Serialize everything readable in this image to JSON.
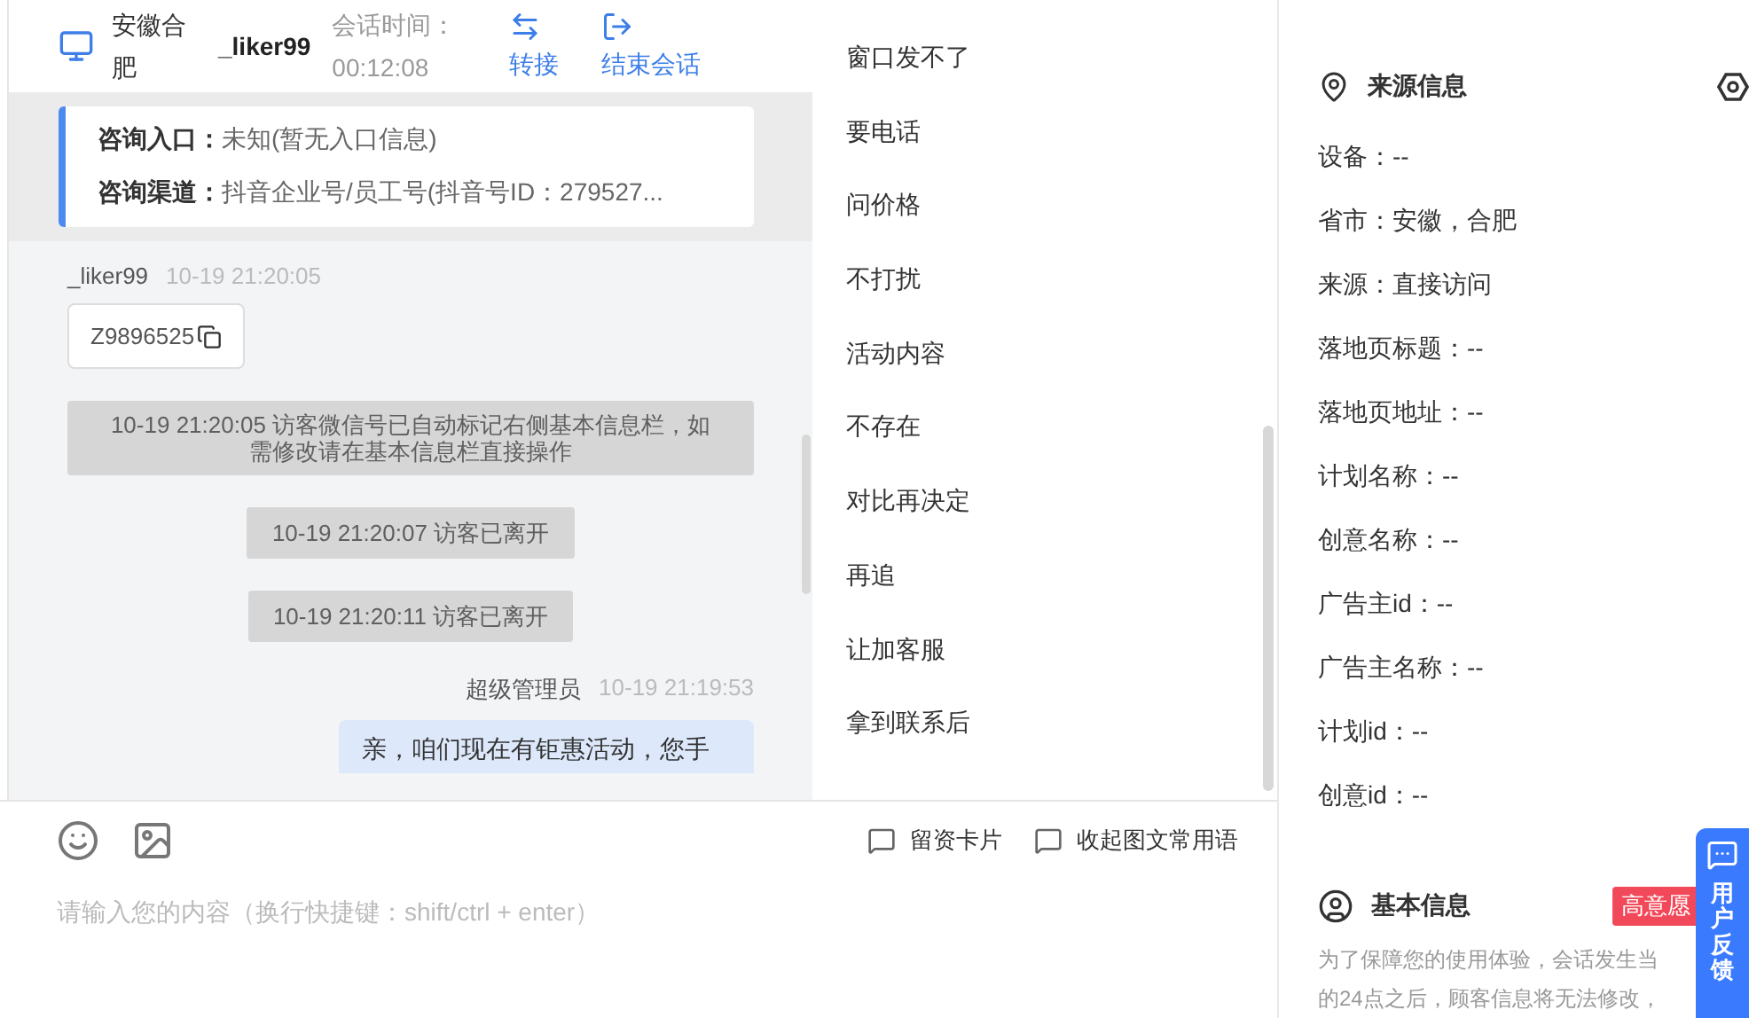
{
  "chat_header": {
    "location": "安徽合肥",
    "visitor": "_liker99",
    "session_time_label": "会话时间：",
    "session_time": "00:12:08",
    "actions": [
      {
        "kind": "transfer",
        "label": "转接"
      },
      {
        "kind": "end",
        "label": "结束会话"
      }
    ]
  },
  "consult_info": [
    "**咨询入口：**未知(暂无入口信息)",
    "**咨询渠道：**抖音企业号/员工号(抖音号ID：279527..."
  ],
  "messages": [
    {
      "kind": "visitor",
      "sender": "_liker99",
      "time": "10-19 21:20:05",
      "text": "Z9896525"
    },
    {
      "kind": "system",
      "text": "10-19 21:20:05 访客微信号已自动标记右侧基本信息栏，如需修改请在基本信息栏直接操作"
    },
    {
      "kind": "system",
      "text": "10-19 21:20:07 访客已离开"
    },
    {
      "kind": "system",
      "text": "10-19 21:20:11 访客已离开"
    },
    {
      "kind": "agent",
      "sender": "超级管理员",
      "time": "10-19 21:19:53",
      "text": "亲，咱们现在有钜惠活动，您手"
    }
  ],
  "quick_phrases": [
    "窗口发不了",
    "要电话",
    "问价格",
    "不打扰",
    "活动内容",
    "不存在",
    "对比再决定",
    "再追",
    "让加客服",
    "拿到联系后"
  ],
  "composer": {
    "tools": [
      "留资卡片",
      "收起图文常用语"
    ],
    "placeholder": "请输入您的内容（换行快捷键：shift/ctrl + enter）"
  },
  "source_info": {
    "title": "来源信息",
    "fields": [
      "设备：--",
      "省市：安徽，合肥",
      "来源：直接访问",
      "落地页标题：--",
      "落地页地址：--",
      "计划名称：--",
      "创意名称：--",
      "广告主id：--",
      "广告主名称：--",
      "计划id：--",
      "创意id：--"
    ]
  },
  "basic_info": {
    "title": "基本信息",
    "badge": "高意愿",
    "notice_lines": [
      "为了保障您的使用体验，会话发生当",
      "的24点之后，顾客信息将无法修改，"
    ]
  },
  "feedback_button": {
    "label": "用户反馈"
  }
}
